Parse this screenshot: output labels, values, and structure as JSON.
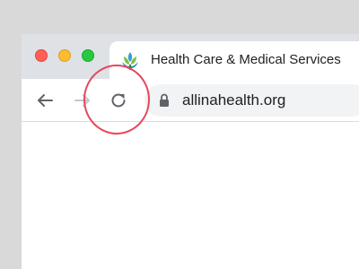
{
  "tab": {
    "title": "Health Care & Medical Services",
    "favicon": "allina-health-logo-icon"
  },
  "toolbar": {
    "back_icon": "arrow-left-icon",
    "forward_icon": "arrow-right-icon",
    "reload_icon": "reload-icon",
    "lock_icon": "lock-icon",
    "url": "allinahealth.org"
  },
  "colors": {
    "ring": "#e8465c",
    "tabbar": "#dee1e6",
    "omnibox": "#f1f3f4"
  }
}
